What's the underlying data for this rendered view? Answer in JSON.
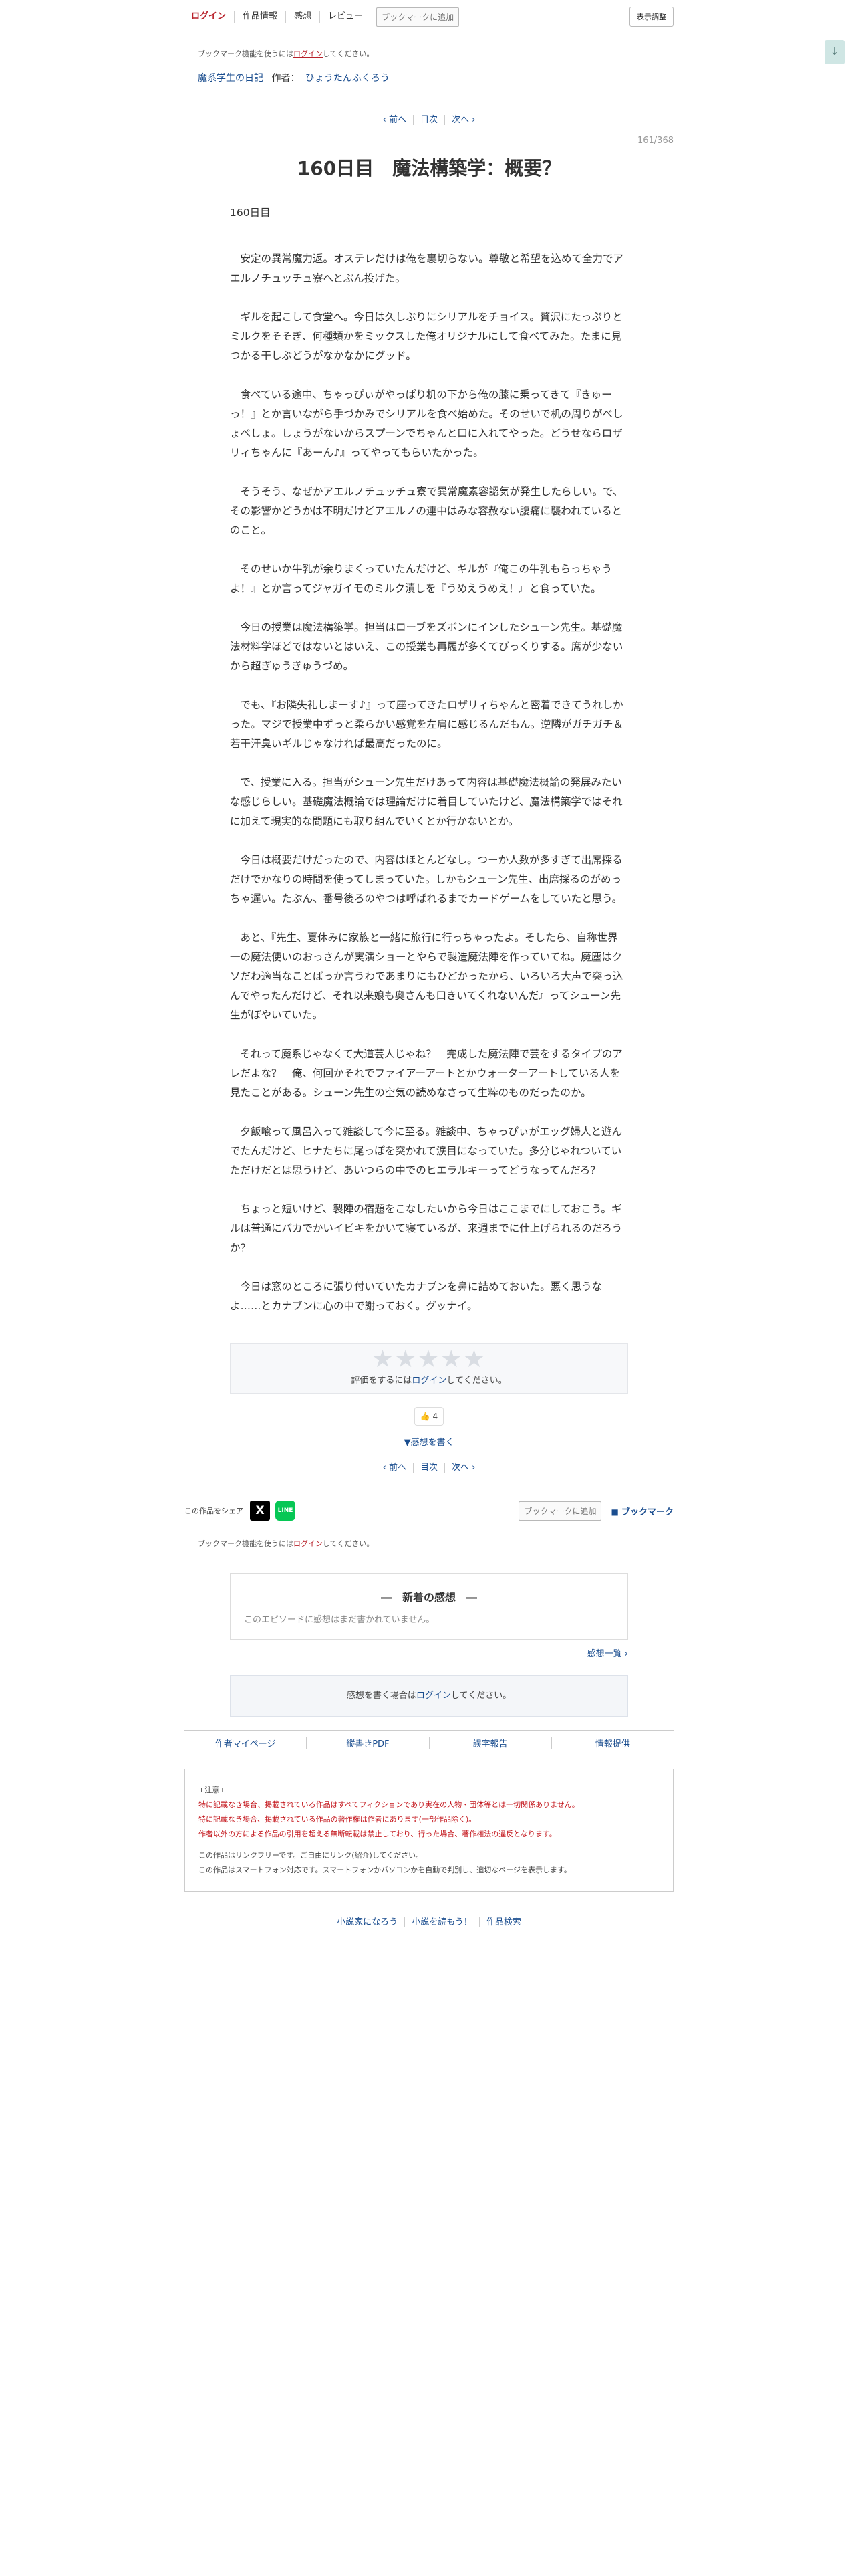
{
  "header": {
    "login": "ログイン",
    "work_info": "作品情報",
    "impressions": "感想",
    "review": "レビュー",
    "bookmark_add": "ブックマークに追加",
    "display_settings": "表示調整"
  },
  "scroll_top_label": "↓",
  "bookmark_notice": {
    "prefix": "ブックマーク機能を使うには",
    "link": "ログイン",
    "suffix": "してください。"
  },
  "series": {
    "title": "魔系学生の日記",
    "author_label": "作者：",
    "author": "ひょうたんふくろう"
  },
  "pager": {
    "prev": "‹ 前へ",
    "toc": "目次",
    "next": "次へ ›"
  },
  "page_number": "161/368",
  "episode_title": "160日目　魔法構築学：概要？",
  "subtitle": "160日目",
  "paragraphs": [
    "　安定の異常魔力返。オステレだけは俺を裏切らない。尊敬と希望を込めて全力でアエルノチュッチュ寮へとぶん投げた。",
    "　ギルを起こして食堂へ。今日は久しぶりにシリアルをチョイス。贅沢にたっぷりとミルクをそそぎ、何種類かをミックスした俺オリジナルにして食べてみた。たまに見つかる干しぶどうがなかなかにグッド。",
    "　食べている途中、ちゃっぴぃがやっぱり机の下から俺の膝に乗ってきて『きゅーっ！』とか言いながら手づかみでシリアルを食べ始めた。そのせいで机の周りがべしょべしょ。しょうがないからスプーンでちゃんと口に入れてやった。どうせならロザリィちゃんに『あーん♪』ってやってもらいたかった。",
    "　そうそう、なぜかアエルノチュッチュ寮で異常魔素容認気が発生したらしい。で、その影響かどうかは不明だけどアエルノの連中はみな容赦ない腹痛に襲われているとのこと。",
    "　そのせいか牛乳が余りまくっていたんだけど、ギルが『俺この牛乳もらっちゃうよ！』とか言ってジャガイモのミルク漬しを『うめえうめえ！』と食っていた。",
    "　今日の授業は魔法構築学。担当はローブをズボンにインしたシューン先生。基礎魔法材料学ほどではないとはいえ、この授業も再履が多くてびっくりする。席が少ないから超ぎゅうぎゅうづめ。",
    "　でも、『お隣失礼しまーす♪』って座ってきたロザリィちゃんと密着できてうれしかった。マジで授業中ずっと柔らかい感覚を左肩に感じるんだもん。逆隣がガチガチ＆若干汗臭いギルじゃなければ最高だったのに。",
    "　で、授業に入る。担当がシューン先生だけあって内容は基礎魔法概論の発展みたいな感じらしい。基礎魔法概論では理論だけに着目していたけど、魔法構築学ではそれに加えて現実的な問題にも取り組んでいくとか行かないとか。",
    "　今日は概要だけだったので、内容はほとんどなし。つーか人数が多すぎて出席採るだけでかなりの時間を使ってしまっていた。しかもシューン先生、出席採るのがめっちゃ遅い。たぶん、番号後ろのやつは呼ばれるまでカードゲームをしていたと思う。",
    "　あと、『先生、夏休みに家族と一緒に旅行に行っちゃったよ。そしたら、自称世界一の魔法使いのおっさんが実演ショーとやらで製造魔法陣を作っていてね。魔塵はクソだわ適当なことばっか言うわであまりにもひどかったから、いろいろ大声で突っ込んでやったんだけど、それ以来娘も奥さんも口きいてくれないんだ』ってシューン先生がぼやいていた。",
    "　それって魔系じゃなくて大道芸人じゃね？　完成した魔法陣で芸をするタイプのアレだよな？　俺、何回かそれでファイアーアートとかウォーターアートしている人を見たことがある。シューン先生の空気の読めなさって生粋のものだったのか。",
    "　夕飯喰って風呂入って雑談して今に至る。雑談中、ちゃっぴぃがエッグ婦人と遊んでたんだけど、ヒナたちに尾っぽを突かれて涙目になっていた。多分じゃれついていただけだとは思うけど、あいつらの中でのヒエラルキーってどうなってんだろ？",
    "　ちょっと短いけど、製陣の宿題をこなしたいから今日はここまでにしておこう。ギルは普通にバカでかいイビキをかいて寝ているが、来週までに仕上げられるのだろうか？",
    "　今日は窓のところに張り付いていたカナブンを鼻に詰めておいた。悪く思うなよ……とカナブンに心の中で謝っておく。グッナイ。"
  ],
  "rating": {
    "stars": "★★★★★",
    "prefix": "評価をするには",
    "link": "ログイン",
    "suffix": "してください。"
  },
  "good_count": "👍 4",
  "write_impression": "▼感想を書く",
  "share": {
    "label": "この作品をシェア",
    "x": "X",
    "line": "LINE",
    "bookmark_add": "ブックマークに追加",
    "bookmark": "ブックマーク"
  },
  "impressions_box": {
    "title": "―　新着の感想　―",
    "empty": "このエピソードに感想はまだ書かれていません。",
    "list_link": "感想一覧 ›"
  },
  "impression_login": {
    "prefix": "感想を書く場合は",
    "link": "ログイン",
    "suffix": "してください。"
  },
  "links": [
    "作者マイページ",
    "縦書きPDF",
    "誤字報告",
    "情報提供"
  ],
  "caution": {
    "head": "+注意+",
    "red": [
      "特に記載なき場合、掲載されている作品はすべてフィクションであり実在の人物・団体等とは一切関係ありません。",
      "特に記載なき場合、掲載されている作品の著作権は作者にあります(一部作品除く)。",
      "作者以外の方による作品の引用を超える無断転載は禁止しており、行った場合、著作権法の違反となります。"
    ],
    "plain": [
      "この作品はリンクフリーです。ご自由にリンク(紹介)してください。",
      "この作品はスマートフォン対応です。スマートフォンかパソコンかを自動で判別し、適切なページを表示します。"
    ]
  },
  "footer_links": [
    "小説家になろう",
    "小説を読もう！",
    "作品検索"
  ]
}
